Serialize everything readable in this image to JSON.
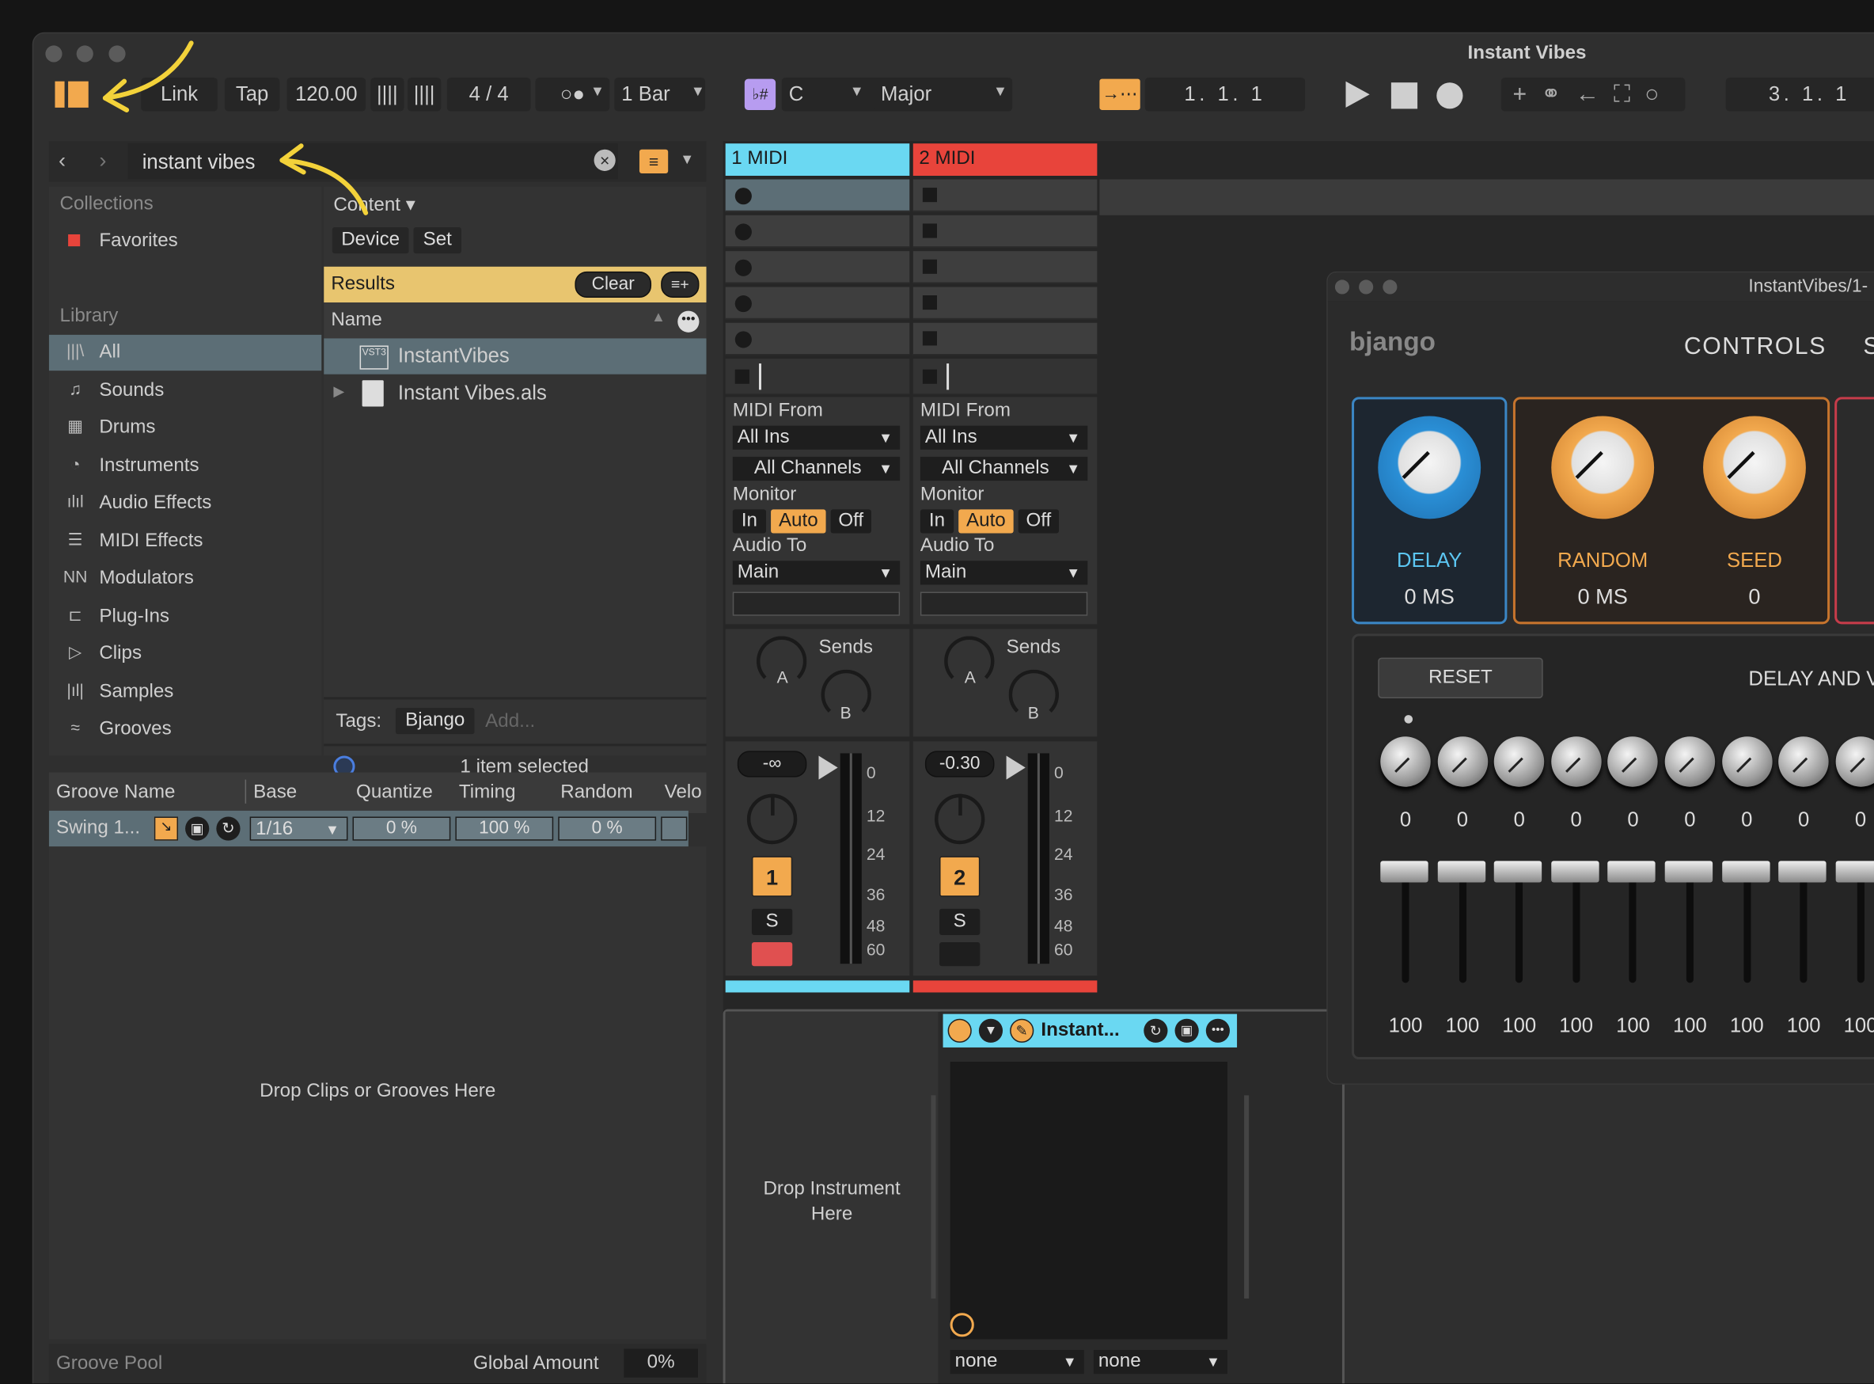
{
  "window": {
    "title": "Instant Vibes"
  },
  "toolbar": {
    "link": "Link",
    "tap": "Tap",
    "tempo": "120.00",
    "signature": "4 / 4",
    "quantize": "1 Bar",
    "key": "C",
    "scale": "Major",
    "position": "1.  1.  1",
    "loop_position": "3.  1.  1"
  },
  "browser": {
    "search": "instant vibes",
    "collections_header": "Collections",
    "favorites": "Favorites",
    "library_header": "Library",
    "library_items": [
      "All",
      "Sounds",
      "Drums",
      "Instruments",
      "Audio Effects",
      "MIDI Effects",
      "Modulators",
      "Plug-Ins",
      "Clips",
      "Samples",
      "Grooves"
    ],
    "content_label": "Content",
    "filters": [
      "Device",
      "Set"
    ],
    "results_label": "Results",
    "clear_label": "Clear",
    "name_header": "Name",
    "results": [
      "InstantVibes",
      "Instant Vibes.als"
    ],
    "tags_label": "Tags:",
    "tag": "Bjango",
    "add_tag": "Add...",
    "status": "1 item selected"
  },
  "groove": {
    "headers": [
      "Groove Name",
      "Base",
      "Quantize",
      "Timing",
      "Random",
      "Velo"
    ],
    "name": "Swing 1...",
    "base": "1/16",
    "quantize": "0 %",
    "timing": "100 %",
    "random": "0 %",
    "drop_hint": "Drop Clips or Grooves Here",
    "pool_label": "Groove Pool",
    "global_label": "Global Amount",
    "global_value": "0%"
  },
  "tracks": [
    {
      "name": "1 MIDI",
      "color": "#6ad8f2",
      "midi_from_label": "MIDI From",
      "midi_from": "All Ins",
      "channels": "All Channels",
      "monitor_label": "Monitor",
      "monitor": [
        "In",
        "Auto",
        "Off"
      ],
      "audio_to_label": "Audio To",
      "audio_to": "Main",
      "sends_label": "Sends",
      "send_a": "A",
      "send_b": "B",
      "volume": "-∞",
      "number": "1",
      "solo": "S"
    },
    {
      "name": "2 MIDI",
      "color": "#e8443b",
      "midi_from_label": "MIDI From",
      "midi_from": "All Ins",
      "channels": "All Channels",
      "monitor_label": "Monitor",
      "monitor": [
        "In",
        "Auto",
        "Off"
      ],
      "audio_to_label": "Audio To",
      "audio_to": "Main",
      "sends_label": "Sends",
      "send_a": "A",
      "send_b": "B",
      "volume": "-0.30",
      "number": "2",
      "solo": "S"
    }
  ],
  "meter_scale": [
    "0",
    "12",
    "24",
    "36",
    "48",
    "60"
  ],
  "device": {
    "drop_hint": "Drop Instrument Here",
    "title": "Instant...",
    "chain_a": "none",
    "chain_b": "none"
  },
  "plugin": {
    "title": "InstantVibes/1-",
    "brand": "bjango",
    "tab": "CONTROLS",
    "tab2": "S",
    "delay_label": "DELAY",
    "delay_value": "0 MS",
    "random_label": "RANDOM",
    "random_value": "0 MS",
    "seed_label": "SEED",
    "seed_value": "0",
    "reset": "RESET",
    "section": "DELAY AND V",
    "knob_values": [
      "0",
      "0",
      "0",
      "0",
      "0",
      "0",
      "0",
      "0",
      "0"
    ],
    "fader_values": [
      "100",
      "100",
      "100",
      "100",
      "100",
      "100",
      "100",
      "100",
      "100"
    ]
  }
}
